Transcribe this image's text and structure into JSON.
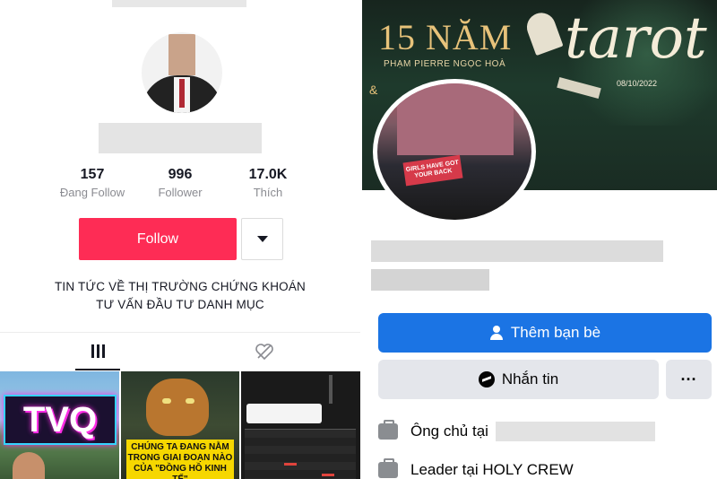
{
  "tiktok": {
    "stats": [
      {
        "value": "157",
        "label": "Đang Follow"
      },
      {
        "value": "996",
        "label": "Follower"
      },
      {
        "value": "17.0K",
        "label": "Thích"
      }
    ],
    "follow_label": "Follow",
    "bio": [
      "TIN TỨC VỀ THỊ TRƯỜNG CHỨNG KHOÁN",
      "TƯ VẤN ĐẦU TƯ DANH MỤC"
    ],
    "videos": [
      {
        "text": "TVQ"
      },
      {
        "text": "CHÚNG TA ĐANG NẰM TRONG GIAI ĐOẠN NÀO CỦA \"ĐỒNG HỒ KINH TẾ\""
      },
      {
        "text": ""
      }
    ],
    "colors": {
      "follow": "#fe2c55"
    }
  },
  "facebook": {
    "cover": {
      "years": "15 NĂM",
      "host": "PHẠM PIERRE NGỌC HOÀ",
      "title": "tarot",
      "date": "08/10/2022",
      "amp": "&"
    },
    "avatar_sign": "GIRLS HAVE GOT YOUR BACK",
    "add_friend_label": "Thêm bạn bè",
    "message_label": "Nhắn tin",
    "more_label": "···",
    "info": [
      {
        "icon": "briefcase-icon",
        "text": "Ông chủ tại"
      },
      {
        "icon": "briefcase-icon",
        "text": "Leader tại HOLY CREW"
      }
    ],
    "colors": {
      "primary": "#1b74e4",
      "secondary": "#e4e6eb"
    }
  }
}
